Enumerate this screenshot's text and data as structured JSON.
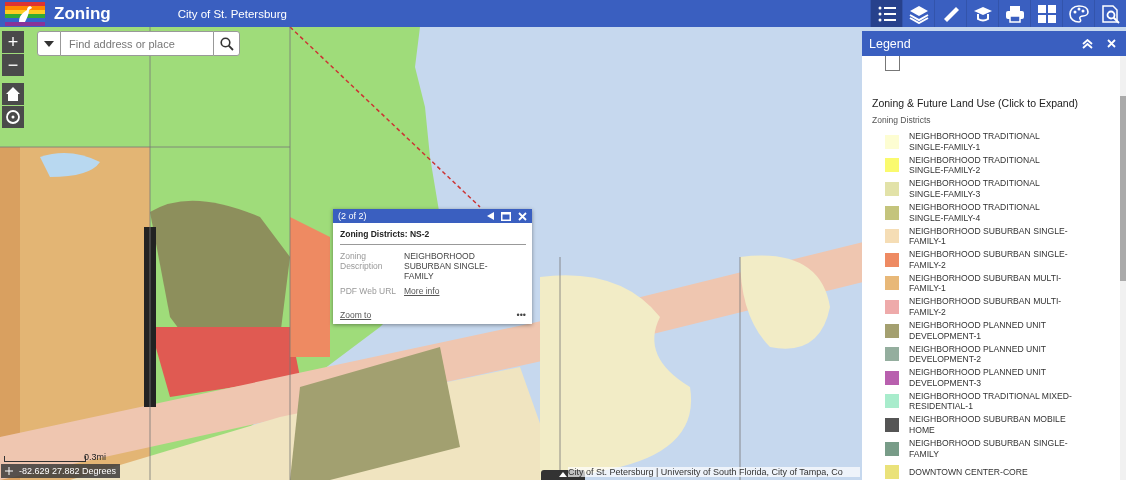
{
  "header": {
    "title": "Zoning",
    "subtitle": "City of St. Petersburg"
  },
  "toolbar": [
    {
      "selected": true
    },
    {
      "selected": false
    },
    {
      "selected": false
    },
    {
      "selected": false
    },
    {
      "selected": false
    },
    {
      "selected": false
    },
    {
      "selected": false
    },
    {
      "selected": false
    }
  ],
  "map_controls": {
    "zoom_in": "+",
    "zoom_out": "−"
  },
  "search": {
    "placeholder": "Find address or place"
  },
  "popup": {
    "pager": "(2 of 2)",
    "title": "Zoning Districts: NS-2",
    "fields": [
      {
        "label": "Zoning Description",
        "value": "NEIGHBORHOOD SUBURBAN SINGLE-FAMILY",
        "kind": "text"
      },
      {
        "label": "PDF Web URL",
        "value": "More info",
        "kind": "link"
      }
    ],
    "zoom_link": "Zoom to",
    "more": "•••"
  },
  "legend": {
    "title": "Legend",
    "checked": false,
    "layer_title": "Zoning & Future Land Use (Click to Expand)",
    "subtitle": "Zoning Districts",
    "items": [
      {
        "label": "NEIGHBORHOOD TRADITIONAL SINGLE-FAMILY-1",
        "color": "#fdfdd2"
      },
      {
        "label": "NEIGHBORHOOD TRADITIONAL SINGLE-FAMILY-2",
        "color": "#fafa6e"
      },
      {
        "label": "NEIGHBORHOOD TRADITIONAL SINGLE-FAMILY-3",
        "color": "#e2e2a8"
      },
      {
        "label": "NEIGHBORHOOD TRADITIONAL SINGLE-FAMILY-4",
        "color": "#c4c47c"
      },
      {
        "label": "NEIGHBORHOOD SUBURBAN SINGLE-FAMILY-1",
        "color": "#f5ddb5"
      },
      {
        "label": "NEIGHBORHOOD SUBURBAN SINGLE-FAMILY-2",
        "color": "#ee8a62"
      },
      {
        "label": "NEIGHBORHOOD SUBURBAN MULTI-FAMILY-1",
        "color": "#e8b878"
      },
      {
        "label": "NEIGHBORHOOD SUBURBAN MULTI-FAMILY-2",
        "color": "#eeaaaa"
      },
      {
        "label": "NEIGHBORHOOD PLANNED UNIT DEVELOPMENT-1",
        "color": "#a4a070"
      },
      {
        "label": "NEIGHBORHOOD PLANNED UNIT DEVELOPMENT-2",
        "color": "#94ae9e"
      },
      {
        "label": "NEIGHBORHOOD PLANNED UNIT DEVELOPMENT-3",
        "color": "#b860ae"
      },
      {
        "label": "NEIGHBORHOOD TRADITIONAL MIXED-RESIDENTIAL-1",
        "color": "#a8eccc"
      },
      {
        "label": "NEIGHBORHOOD SUBURBAN MOBILE HOME",
        "color": "#555555"
      },
      {
        "label": "NEIGHBORHOOD SUBURBAN SINGLE-FAMILY",
        "color": "#789c88"
      },
      {
        "label": "DOWNTOWN CENTER-CORE",
        "color": "#eae27a"
      }
    ]
  },
  "scale": {
    "label": "0.3mi"
  },
  "coordinates": "-82.629 27.882 Degrees",
  "attribution": "City of St. Petersburg | University of South Florida, City of Tampa, Co"
}
